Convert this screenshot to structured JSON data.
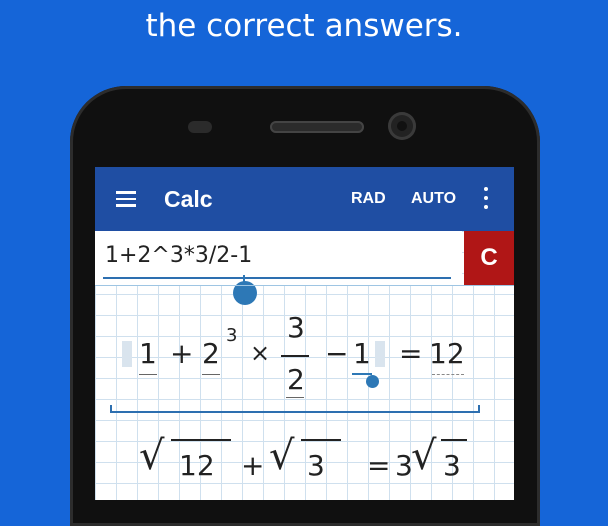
{
  "caption": {
    "line1": "",
    "line2": "the correct answers."
  },
  "app": {
    "title": "Calc",
    "angle_mode": "RAD",
    "format_mode": "AUTO",
    "menu_icon": "hamburger-menu-icon",
    "more_icon": "more-vert-icon"
  },
  "input": {
    "expression": "1+2^3*3/2-1"
  },
  "clear_button": {
    "label": "C",
    "color": "#b01616"
  },
  "result1": {
    "term1": "1",
    "plus": "+",
    "base": "2",
    "exponent": "3",
    "times": "×",
    "numerator": "3",
    "denominator": "2",
    "minus": "−",
    "term4": "1",
    "equals": "=",
    "answer": "12"
  },
  "result2": {
    "rad1": "12",
    "plus": "+",
    "rad2": "3",
    "equals": "=",
    "coef": "3",
    "rad3": "3"
  },
  "colors": {
    "background": "#1565d8",
    "appbar": "#1f4ea3",
    "accent": "#2d78b6"
  }
}
